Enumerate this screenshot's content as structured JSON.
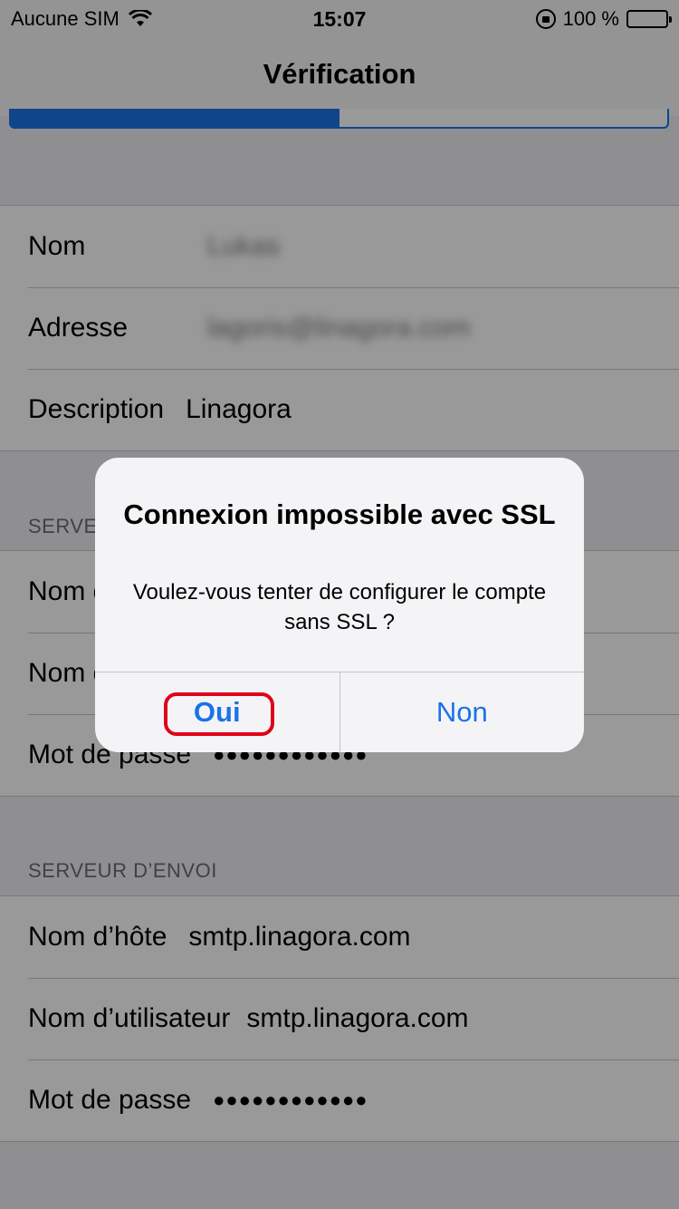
{
  "status_bar": {
    "carrier": "Aucune SIM",
    "time": "15:07",
    "battery_percent": "100 %"
  },
  "nav": {
    "title": "Vérification"
  },
  "progress": {
    "fraction": 0.5
  },
  "account": {
    "rows": [
      {
        "label": "Nom",
        "value": "Lukas",
        "blurred": true
      },
      {
        "label": "Adresse",
        "value": "lagoris@linagora.com",
        "blurred": true
      },
      {
        "label": "Description",
        "value": "Linagora",
        "blurred": false
      }
    ]
  },
  "incoming": {
    "header": "SERVEUR DE RÉCEPTION",
    "rows": [
      {
        "label": "Nom d’hôte",
        "value": ""
      },
      {
        "label": "Nom d’utilisateur",
        "value": ""
      },
      {
        "label": "Mot de passe",
        "value": "●●●●●●●●●●●●"
      }
    ]
  },
  "outgoing": {
    "header": "SERVEUR D’ENVOI",
    "rows": [
      {
        "label": "Nom d’hôte",
        "value": "smtp.linagora.com"
      },
      {
        "label": "Nom d’utilisateur",
        "value": "smtp.linagora.com"
      },
      {
        "label": "Mot de passe",
        "value": "●●●●●●●●●●●●"
      }
    ]
  },
  "alert": {
    "title": "Connexion impossible avec SSL",
    "message": "Voulez-vous tenter de configurer le compte sans SSL ?",
    "yes_label": "Oui",
    "no_label": "Non"
  },
  "colors": {
    "accent": "#1a73e8",
    "highlight": "#e0001a"
  }
}
